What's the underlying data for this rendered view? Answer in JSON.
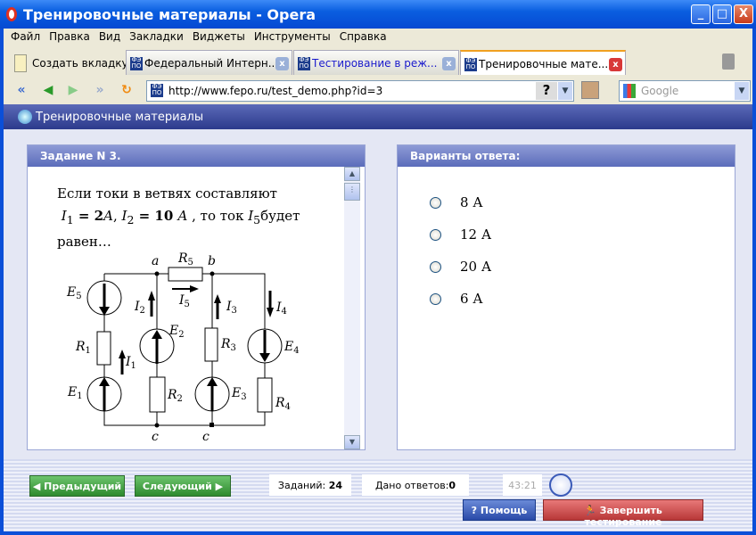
{
  "window": {
    "title": "Тренировочные материалы - Opera",
    "minimize": "_",
    "maximize": "□",
    "close": "X"
  },
  "menu": [
    "Файл",
    "Правка",
    "Вид",
    "Закладки",
    "Виджеты",
    "Инструменты",
    "Справка"
  ],
  "tabs": {
    "new_tab": "Создать вкладку",
    "items": [
      {
        "label": "Федеральный Интерн..."
      },
      {
        "label": "Тестирование в реж..."
      },
      {
        "label": "Тренировочные мате..."
      }
    ],
    "close": "x"
  },
  "nav": {
    "url": "http://www.fepo.ru/test_demo.php?id=3",
    "help": "?",
    "search_placeholder": "Google"
  },
  "page": {
    "header": "Тренировочные материалы"
  },
  "task": {
    "header": "Задание N 3.",
    "text_line1": "Если токи в ветвях составляют",
    "i1": "I",
    "i1_sub": "1",
    "eq1": " = 2",
    "unit1": "A",
    "sep": ", ",
    "i2": "I",
    "i2_sub": "2",
    "eq2": " = 10 ",
    "unit2": "A",
    "mid": " , то ток ",
    "i5": "I",
    "i5_sub": "5",
    "tail": "будет",
    "line3": "равен…"
  },
  "circuit": {
    "labels": {
      "a": "a",
      "b": "b",
      "c1": "c",
      "c2": "c",
      "R5": "R",
      "R5s": "5",
      "R1": "R",
      "R1s": "1",
      "R2": "R",
      "R2s": "2",
      "R3": "R",
      "R3s": "3",
      "R4": "R",
      "R4s": "4",
      "E1": "E",
      "E1s": "1",
      "E2": "E",
      "E2s": "2",
      "E3": "E",
      "E3s": "3",
      "E4": "E",
      "E4s": "4",
      "E5": "E",
      "E5s": "5",
      "I1": "I",
      "I1s": "1",
      "I2": "I",
      "I2s": "2",
      "I3": "I",
      "I3s": "3",
      "I4": "I",
      "I4s": "4",
      "I5": "I",
      "I5s": "5"
    }
  },
  "answers": {
    "header": "Варианты ответа:",
    "options": [
      "8 А",
      "12 А",
      "20 А",
      "6 А"
    ]
  },
  "footer": {
    "prev": "Предыдущий",
    "next": "Следующий",
    "tasks_label": "Заданий: ",
    "tasks_count": "24",
    "answered_label": "Дано ответов:",
    "answered_count": "0",
    "timer": "43:21",
    "help": "Помощь",
    "finish": "Завершить тестирование"
  }
}
